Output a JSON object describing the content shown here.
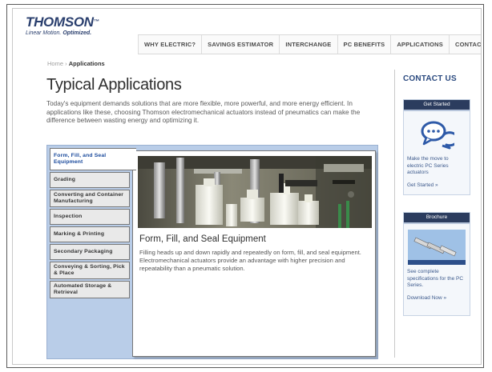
{
  "brand": {
    "logo_text": "THOMSON",
    "tagline_prefix": "Linear Motion.",
    "tagline_bold": "Optimized."
  },
  "nav": {
    "items": [
      "WHY ELECTRIC?",
      "SAVINGS ESTIMATOR",
      "INTERCHANGE",
      "PC BENEFITS",
      "APPLICATIONS",
      "CONTACT US"
    ]
  },
  "breadcrumb": {
    "home": "Home",
    "separator": "›",
    "current": "Applications"
  },
  "page": {
    "title": "Typical Applications",
    "intro": "Today's equipment demands solutions that are more flexible, more powerful, and more energy efficient. In applications like these, choosing Thomson electromechanical actuators instead of pneumatics can make the difference between wasting energy and optimizing it."
  },
  "tabs": [
    "Form, Fill, and Seal Equipment",
    "Grading",
    "Converting and Container Manufacturing",
    "Inspection",
    "Marking & Printing",
    "Secondary Packaging",
    "Conveying & Sorting, Pick & Place",
    "Automated Storage & Retrieval"
  ],
  "active_tab_index": 0,
  "detail": {
    "title": "Form, Fill, and Seal Equipment",
    "description": "Filling heads up and down rapidly and repeatedly on form, fill, and seal equipment. Electromechanical actuators provide an advantage with higher precision and repeatability than a pneumatic solution."
  },
  "sidebar": {
    "heading": "CONTACT US",
    "get_started": {
      "header": "Get Started",
      "text": "Make the move to electric PC Series actuators",
      "link": "Get Started »",
      "icon": "chat-bubbles-icon"
    },
    "brochure": {
      "header": "Brochure",
      "text": "See complete specifications for the PC Series.",
      "link": "Download Now »",
      "icon": "brochure-actuators-icon"
    }
  },
  "colors": {
    "brand_blue": "#2a3f6e",
    "panel_blue": "#b9cde8",
    "active_tab_text": "#1a4a9c",
    "link_blue": "#3d5a8c",
    "card_header": "#2b3c5e"
  }
}
